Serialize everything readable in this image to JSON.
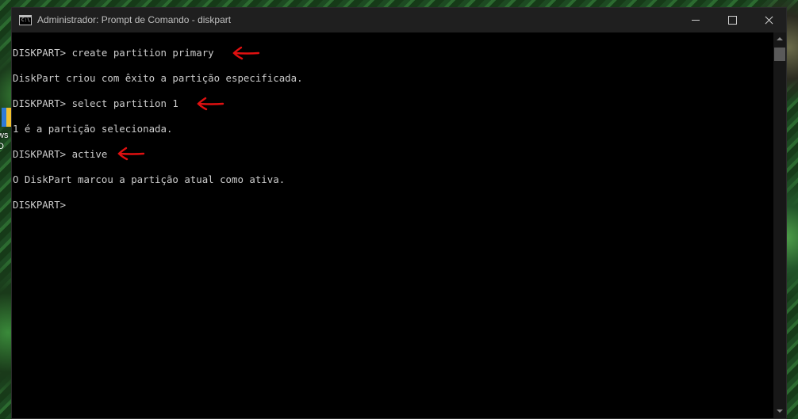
{
  "desktop": {
    "icon_label": "ws\nD"
  },
  "window": {
    "title": "Administrador: Prompt de Comando - diskpart",
    "icon_text": "C:\\"
  },
  "console": {
    "lines": [
      "DISKPART> create partition primary",
      "DiskPart criou com êxito a partição especificada.",
      "DISKPART> select partition 1",
      "1 é a partição selecionada.",
      "DISKPART> active",
      "O DiskPart marcou a partição atual como ativa.",
      "DISKPART>"
    ]
  },
  "colors": {
    "console_background": "#000000",
    "console_text": "#cccccc",
    "titlebar": "#1f1f1f",
    "annotation_arrow": "#e01010"
  },
  "icons": {
    "window_icon": "cmd-icon",
    "minimize": "minimize-icon",
    "maximize": "maximize-icon",
    "close": "close-icon",
    "annotation": "arrow-left-icon"
  }
}
